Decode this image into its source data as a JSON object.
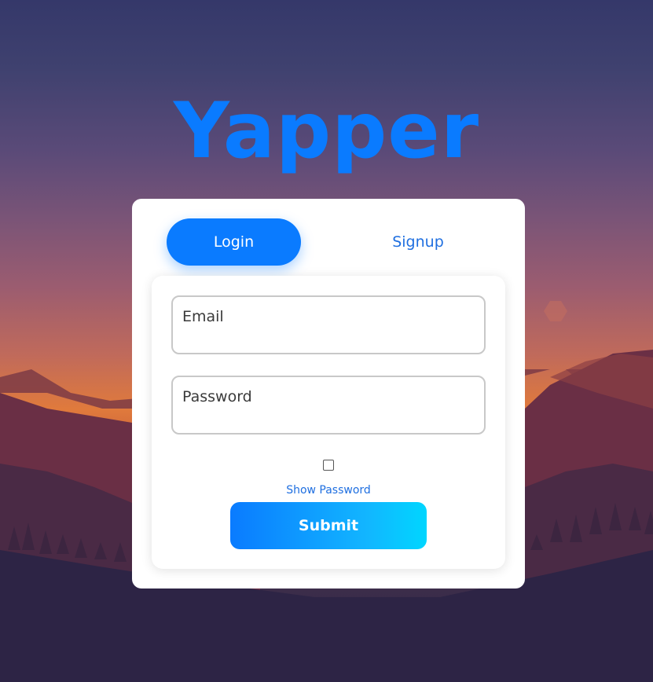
{
  "app": {
    "title": "Yapper"
  },
  "tabs": {
    "login_label": "Login",
    "signup_label": "Signup"
  },
  "form": {
    "email_placeholder": "Email",
    "password_placeholder": "Password",
    "show_password_label": "Show Password",
    "show_password_checked": false,
    "submit_label": "Submit"
  },
  "colors": {
    "brand": "#0a7bff",
    "submit_gradient_end": "#00d6ff",
    "card_background": "#ffffff"
  },
  "icons": {
    "checkbox": "unchecked-checkbox-icon"
  }
}
